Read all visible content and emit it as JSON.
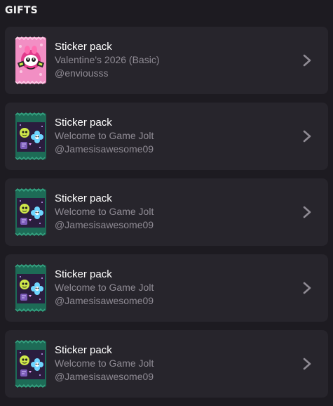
{
  "header": {
    "title": "GIFTS"
  },
  "colors": {
    "background": "#1d1b21",
    "card": "#27252c",
    "secondary_text": "#8f8b94",
    "pack_pink": "#f28fc4",
    "pack_green": "#1d6b56"
  },
  "gifts": [
    {
      "title": "Sticker pack",
      "pack_name": "Valentine's 2026 (Basic)",
      "sender": "@enviousss",
      "pack_style": "valentine",
      "chevron_icon": "chevron-right-icon"
    },
    {
      "title": "Sticker pack",
      "pack_name": "Welcome to Game Jolt",
      "sender": "@Jamesisawesome09",
      "pack_style": "welcome",
      "chevron_icon": "chevron-right-icon"
    },
    {
      "title": "Sticker pack",
      "pack_name": "Welcome to Game Jolt",
      "sender": "@Jamesisawesome09",
      "pack_style": "welcome",
      "chevron_icon": "chevron-right-icon"
    },
    {
      "title": "Sticker pack",
      "pack_name": "Welcome to Game Jolt",
      "sender": "@Jamesisawesome09",
      "pack_style": "welcome",
      "chevron_icon": "chevron-right-icon"
    },
    {
      "title": "Sticker pack",
      "pack_name": "Welcome to Game Jolt",
      "sender": "@Jamesisawesome09",
      "pack_style": "welcome",
      "chevron_icon": "chevron-right-icon"
    }
  ]
}
